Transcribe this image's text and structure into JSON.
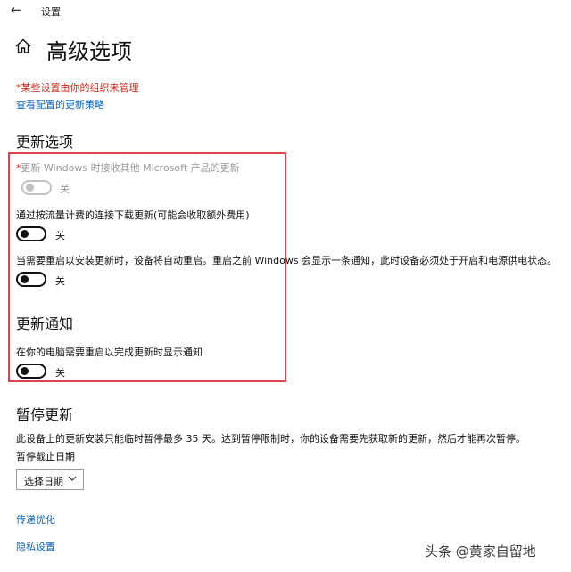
{
  "window": {
    "back_icon": "arrow-left-icon",
    "title": "设置"
  },
  "header": {
    "home_icon": "home-icon",
    "title": "高级选项"
  },
  "notice": {
    "managed_text": "*某些设置由你的组织来管理",
    "policy_link": "查看配置的更新策略"
  },
  "update_options": {
    "heading": "更新选项",
    "items": [
      {
        "star": "*",
        "label": "更新 Windows 时接收其他 Microsoft 产品的更新",
        "state": "关",
        "on": false,
        "disabled": true
      },
      {
        "label": "通过按流量计费的连接下载更新(可能会收取额外费用)",
        "state": "关",
        "on": false,
        "disabled": false
      },
      {
        "label": "当需要重启以安装更新时，设备将自动重启。重启之前 Windows 会显示一条通知，此时设备必须处于开启和电源供电状态。",
        "state": "关",
        "on": false,
        "disabled": false
      }
    ]
  },
  "update_notifications": {
    "heading": "更新通知",
    "items": [
      {
        "label": "在你的电脑需要重启以完成更新时显示通知",
        "state": "关",
        "on": false,
        "disabled": false
      }
    ]
  },
  "pause_updates": {
    "heading": "暂停更新",
    "description": "此设备上的更新安装只能临时暂停最多 35 天。达到暂停限制时，你的设备需要先获取新的更新，然后才能再次暂停。",
    "date_label": "暂停截止日期",
    "select_value": "选择日期"
  },
  "links": {
    "delivery_optimization": "传递优化",
    "privacy_settings": "隐私设置"
  },
  "watermark": "头条 @黄家自留地",
  "colors": {
    "managed_red": "#c42b1c",
    "link_blue": "#0b63b6",
    "frame_red": "#d9454a"
  }
}
